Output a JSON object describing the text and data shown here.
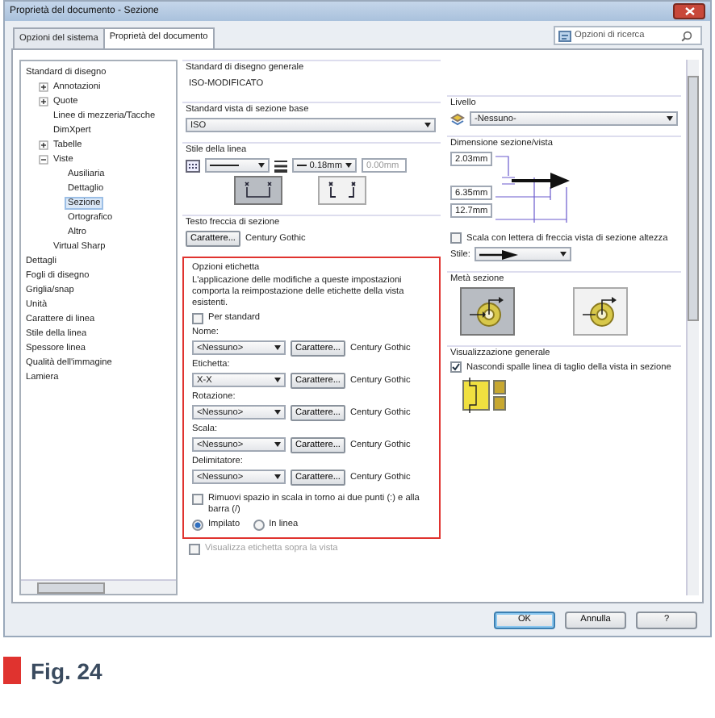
{
  "window": {
    "title": "Proprietà del documento - Sezione"
  },
  "tabs": [
    {
      "label": "Opzioni del sistema",
      "selected": false
    },
    {
      "label": "Proprietà del documento",
      "selected": true
    }
  ],
  "search": {
    "placeholder": "Opzioni di ricerca"
  },
  "tree": [
    {
      "label": "Standard di disegno",
      "selected": false,
      "children": [
        {
          "label": "Annotazioni",
          "selected": false,
          "expanded": false
        },
        {
          "label": "Quote",
          "selected": false,
          "expanded": false
        },
        {
          "label": "Linee di mezzeria/Tacche",
          "selected": false
        },
        {
          "label": "DimXpert",
          "selected": false
        },
        {
          "label": "Tabelle",
          "selected": false,
          "expanded": false
        },
        {
          "label": "Viste",
          "selected": false,
          "expanded": true,
          "children": [
            {
              "label": "Ausiliaria",
              "selected": false
            },
            {
              "label": "Dettaglio",
              "selected": false
            },
            {
              "label": "Sezione",
              "selected": true
            },
            {
              "label": "Ortografico",
              "selected": false
            },
            {
              "label": "Altro",
              "selected": false
            }
          ]
        },
        {
          "label": "Virtual Sharp",
          "selected": false
        }
      ]
    },
    {
      "label": "Dettagli",
      "selected": false
    },
    {
      "label": "Fogli di disegno",
      "selected": false
    },
    {
      "label": "Griglia/snap",
      "selected": false
    },
    {
      "label": "Unità",
      "selected": false
    },
    {
      "label": "Carattere di linea",
      "selected": false
    },
    {
      "label": "Stile della linea",
      "selected": false
    },
    {
      "label": "Spessore linea",
      "selected": false
    },
    {
      "label": "Qualità dell'immagine",
      "selected": false
    },
    {
      "label": "Lamiera",
      "selected": false
    }
  ],
  "general_standard": {
    "label": "Standard di disegno generale",
    "value": "ISO-MODIFICATO"
  },
  "base_standard": {
    "label": "Standard vista di sezione base",
    "value": "ISO"
  },
  "line_style": {
    "label": "Stile della linea",
    "thickness": "0.18mm",
    "custom": "0.00mm",
    "options": [
      {
        "selected": true
      },
      {
        "selected": false
      }
    ]
  },
  "arrow_text": {
    "label": "Testo freccia di sezione",
    "button": "Carattere...",
    "font": "Century Gothic"
  },
  "label_options": {
    "title": "Opzioni etichetta",
    "note": "L'applicazione delle modifiche a queste impostazioni comporta la reimpostazione delle etichette della vista esistenti.",
    "per_standard": {
      "label": "Per standard",
      "checked": false
    },
    "fields": [
      {
        "label": "Nome:",
        "value": "<Nessuno>",
        "button": "Carattere...",
        "font": "Century Gothic"
      },
      {
        "label": "Etichetta:",
        "value": "X-X",
        "button": "Carattere...",
        "font": "Century Gothic"
      },
      {
        "label": "Rotazione:",
        "value": "<Nessuno>",
        "button": "Carattere...",
        "font": "Century Gothic"
      },
      {
        "label": "Scala:",
        "value": "<Nessuno>",
        "button": "Carattere...",
        "font": "Century Gothic"
      },
      {
        "label": "Delimitatore:",
        "value": "<Nessuno>",
        "button": "Carattere...",
        "font": "Century Gothic"
      }
    ],
    "remove_space": {
      "label": "Rimuovi spazio in scala in torno ai due punti (:) e alla barra (/)",
      "checked": false
    },
    "layout": [
      {
        "label": "Impilato",
        "selected": true
      },
      {
        "label": "In linea",
        "selected": false
      }
    ]
  },
  "show_label": {
    "label": "Visualizza etichetta sopra la vista",
    "checked": false,
    "disabled": true
  },
  "layer": {
    "label": "Livello",
    "value": "-Nessuno-"
  },
  "size": {
    "label": "Dimensione sezione/vista",
    "values": [
      "2.03mm",
      "6.35mm",
      "12.7mm"
    ]
  },
  "scale_with_letter": {
    "label": "Scala con lettera di freccia vista di sezione altezza",
    "checked": false
  },
  "style": {
    "label": "Stile:"
  },
  "half_section": {
    "label": "Metà sezione",
    "options": [
      {
        "selected": true
      },
      {
        "selected": false
      }
    ]
  },
  "general_display": {
    "label": "Visualizzazione generale",
    "hide_shoulders": {
      "label": "Nascondi spalle linea di taglio della vista in sezione",
      "checked": true
    }
  },
  "buttons": [
    {
      "label": "OK",
      "default": true
    },
    {
      "label": "Annulla",
      "default": false
    },
    {
      "label": "?",
      "default": false
    }
  ],
  "caption": {
    "label": "Fig. 24"
  }
}
